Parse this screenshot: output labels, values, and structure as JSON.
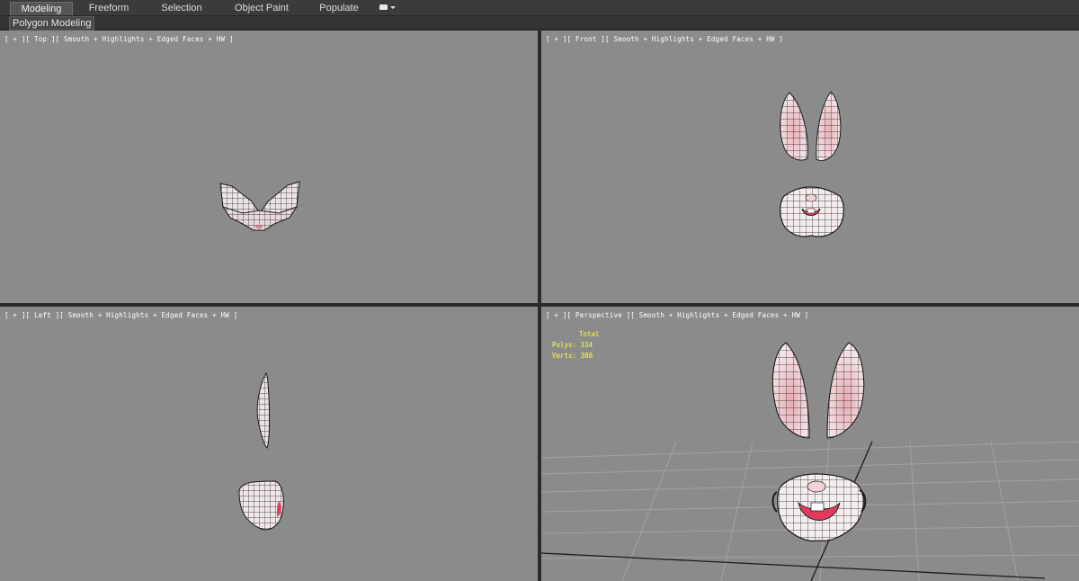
{
  "ribbon": {
    "tabs": [
      {
        "label": "Modeling",
        "active": true
      },
      {
        "label": "Freeform",
        "active": false
      },
      {
        "label": "Selection",
        "active": false
      },
      {
        "label": "Object Paint",
        "active": false
      },
      {
        "label": "Populate",
        "active": false
      }
    ],
    "panel_label": "Polygon Modeling"
  },
  "viewports": {
    "top": {
      "label": "[ + ][ Top ][ Smooth + Highlights + Edged Faces + HW ]"
    },
    "front": {
      "label": "[ + ][ Front ][ Smooth + Highlights + Edged Faces + HW ]"
    },
    "left": {
      "label": "[ + ][ Left ][ Smooth + Highlights + Edged Faces + HW ]"
    },
    "perspective": {
      "label": "[ + ][ Perspective ][ Smooth + Highlights + Edged Faces + HW ]"
    }
  },
  "stats": {
    "total_label": "Total",
    "polys_label": "Polys:",
    "polys_value": "334",
    "verts_label": "Verts:",
    "verts_value": "388"
  },
  "colors": {
    "viewport_bg": "#8b8b8b",
    "stats_text": "#ffff3a",
    "mesh_skin": "#f1dfe1",
    "mesh_inner": "#e9b0b8",
    "mouth_red": "#e23a5c"
  }
}
